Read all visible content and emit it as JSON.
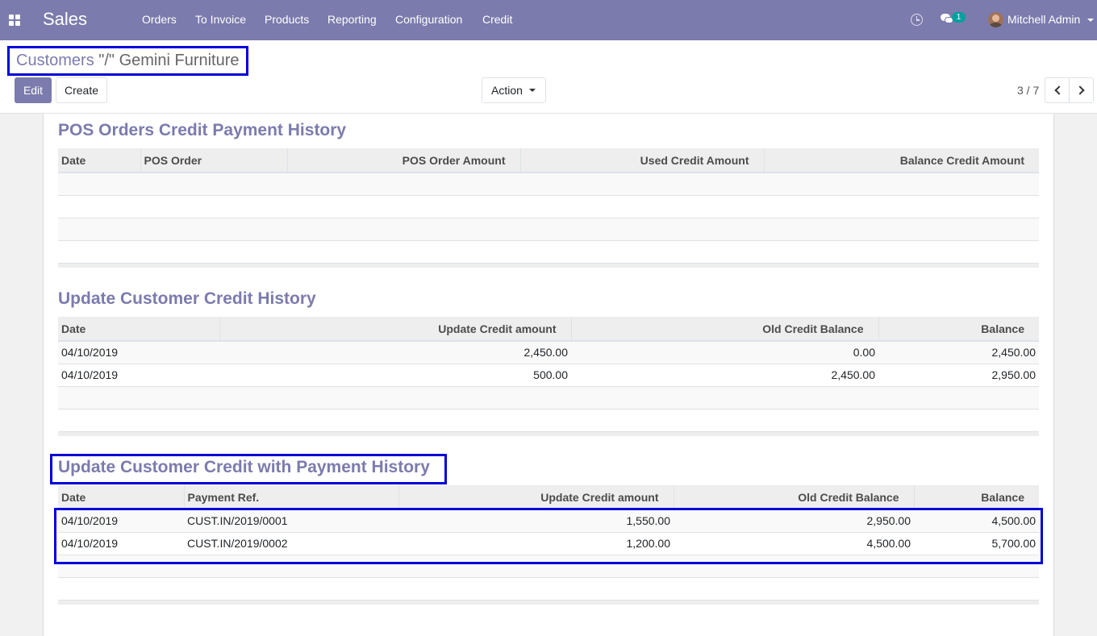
{
  "navbar": {
    "app_name": "Sales",
    "menu": [
      "Orders",
      "To Invoice",
      "Products",
      "Reporting",
      "Configuration",
      "Credit"
    ],
    "messages_badge": "1",
    "user": "Mitchell Admin"
  },
  "breadcrumb": {
    "parent": "Customers",
    "separator": " \"/\" ",
    "current": "Gemini Furniture"
  },
  "buttons": {
    "edit": "Edit",
    "create": "Create",
    "action": "Action"
  },
  "pager": {
    "text": "3 / 7"
  },
  "pos_history": {
    "title": "POS Orders Credit Payment History",
    "columns": [
      "Date",
      "POS Order",
      "POS Order Amount",
      "Used Credit Amount",
      "Balance Credit Amount"
    ]
  },
  "update_history": {
    "title": "Update Customer Credit History",
    "columns": [
      "Date",
      "Update Credit amount",
      "Old Credit Balance",
      "Balance"
    ],
    "rows": [
      [
        "04/10/2019",
        "2,450.00",
        "0.00",
        "2,450.00"
      ],
      [
        "04/10/2019",
        "500.00",
        "2,450.00",
        "2,950.00"
      ]
    ]
  },
  "payment_history": {
    "title": "Update Customer Credit with Payment History",
    "columns": [
      "Date",
      "Payment Ref.",
      "Update Credit amount",
      "Old Credit Balance",
      "Balance"
    ],
    "rows": [
      [
        "04/10/2019",
        "CUST.IN/2019/0001",
        "1,550.00",
        "2,950.00",
        "4,500.00"
      ],
      [
        "04/10/2019",
        "CUST.IN/2019/0002",
        "1,200.00",
        "4,500.00",
        "5,700.00"
      ]
    ]
  },
  "colors": {
    "brand": "#7c7bad",
    "highlight": "#0000d9",
    "badge": "#00a09d"
  }
}
